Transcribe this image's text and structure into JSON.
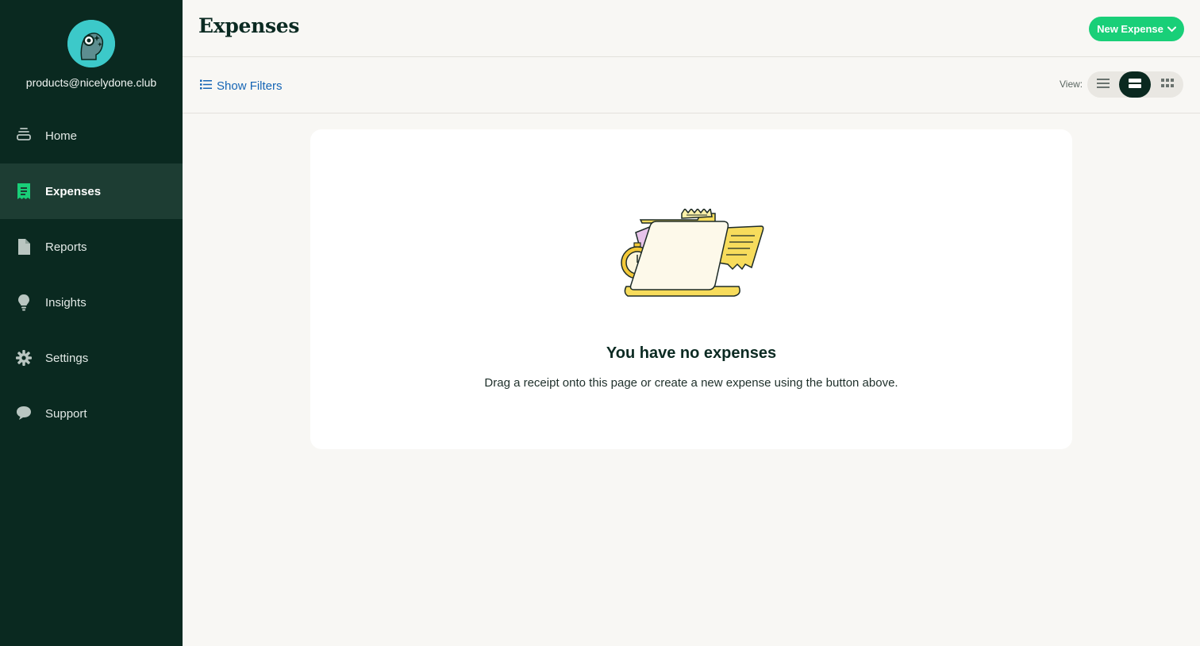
{
  "user": {
    "email": "products@nicelydone.club"
  },
  "sidebar": {
    "items": [
      {
        "label": "Home",
        "icon": "home-stack-icon"
      },
      {
        "label": "Expenses",
        "icon": "receipt-icon",
        "active": true
      },
      {
        "label": "Reports",
        "icon": "document-icon"
      },
      {
        "label": "Insights",
        "icon": "lightbulb-icon"
      },
      {
        "label": "Settings",
        "icon": "gear-icon"
      },
      {
        "label": "Support",
        "icon": "chat-bubble-icon"
      }
    ]
  },
  "header": {
    "title": "Expenses",
    "new_button_label": "New Expense"
  },
  "toolbar": {
    "filters_label": "Show Filters",
    "view_label": "View:",
    "view_options": [
      "list",
      "card",
      "grid"
    ],
    "active_view": "card"
  },
  "empty_state": {
    "title": "You have no expenses",
    "subtitle": "Drag a receipt onto this page or create a new expense using the button above."
  },
  "colors": {
    "sidebar_bg": "#0a2920",
    "sidebar_active_bg": "#1d3d33",
    "accent_green": "#19cf78",
    "link_blue": "#1565b5",
    "avatar_teal": "#3cc9c9"
  }
}
